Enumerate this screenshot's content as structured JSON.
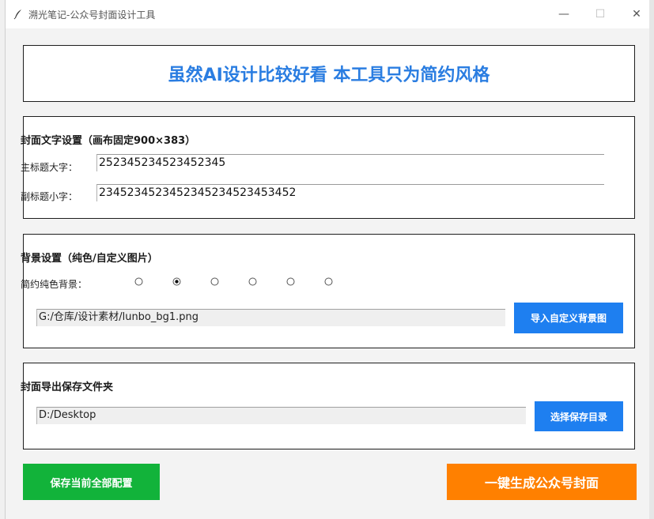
{
  "window": {
    "title": "溯光笔记-公众号封面设计工具",
    "minimize_glyph": "—",
    "maximize_glyph": "☐",
    "close_glyph": "✕",
    "app_icon": "feather-icon"
  },
  "banner": {
    "text": "虽然AI设计比较好看 本工具只为简约风格",
    "color": "#2a7de1"
  },
  "cover_text": {
    "title": "封面文字设置（画布固定900×383）",
    "main_title_label": "主标题大字：",
    "main_title_value": "252345234523452345",
    "sub_title_label": "副标题小字：",
    "sub_title_value": "2345234523452345234523453452"
  },
  "background": {
    "title": "背景设置（纯色/自定义图片）",
    "solid_label": "简约纯色背景：",
    "solid_options_selected_index": 1,
    "solid_options_count": 6,
    "image_path": "G:/仓库/设计素材/lunbo_bg1.png",
    "import_button": "导入自定义背景图"
  },
  "export": {
    "title": "封面导出保存文件夹",
    "folder_path": "D:/Desktop",
    "choose_button": "选择保存目录"
  },
  "actions": {
    "save_config": "保存当前全部配置",
    "generate": "一键生成公众号封面"
  },
  "colors": {
    "accent_blue": "#1e7ff0",
    "save_green": "#12b33a",
    "generate_orange": "#ff8000"
  }
}
